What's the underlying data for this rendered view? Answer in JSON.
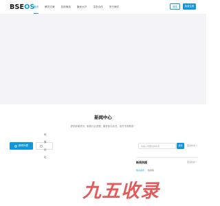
{
  "header": {
    "logo_prefix": "BSE",
    "logo_accent": "OS",
    "nav": [
      {
        "label": "首页",
        "active": true
      },
      {
        "label": "解决方案",
        "active": false
      },
      {
        "label": "应用商品",
        "active": false
      },
      {
        "label": "聚优大厅",
        "active": false
      },
      {
        "label": "生态合作",
        "active": false
      },
      {
        "label": "关于我们",
        "active": false
      }
    ],
    "login_label": "登录",
    "register_label": "免费注册"
  },
  "news": {
    "title": "新闻中心",
    "description": "提供新闻资讯、聚焦行业发展、解析前沿动态，探究市场需求！",
    "tabs": [
      {
        "label": "新闻列表",
        "active": true,
        "icon": "list-icon"
      },
      {
        "label": "优秀论坛",
        "active": false,
        "icon": "forum-icon"
      }
    ],
    "search_placeholder": "请输入你要找的新闻",
    "search_button": "搜索",
    "more_label": "更多新闻 >",
    "hot": {
      "title": "新闻热搜",
      "more_label": "更多热搜 >",
      "tabs": [
        {
          "label": "热点资讯",
          "active": true
        },
        {
          "label": "热搜榜",
          "active": false
        }
      ]
    }
  },
  "watermark": {
    "text": "九五收录",
    "color": "#dd4040"
  },
  "colors": {
    "brand": "#1196db",
    "banner_bg": "#f4f4f6"
  }
}
